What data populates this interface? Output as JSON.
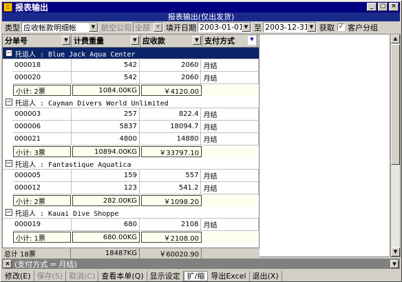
{
  "window": {
    "title": "报表输出",
    "subtitle": "报表输出(仅出发货)",
    "minimize": "_",
    "restore": "□",
    "close": "×",
    "icon_glyph": "☰"
  },
  "filters": {
    "type_label": "类型",
    "type_value": "应收帐款明细帐",
    "airline_label": "航空公司",
    "airline_value": "全部",
    "date_label": "填开日期",
    "date_from": "2003-01-01",
    "to_label": "至",
    "date_to": "2003-12-31",
    "fetch_label": "获取",
    "fetch_checked": "✓",
    "group_label": "客户分组"
  },
  "columns": [
    "分单号",
    "计费重量",
    "应收款",
    "支付方式"
  ],
  "groups": [
    {
      "label": "托运人 : Blue Jack Aqua Center",
      "rows": [
        {
          "id": "000018",
          "weight": "542",
          "amount": "2060",
          "pay": "月结"
        },
        {
          "id": "000020",
          "weight": "542",
          "amount": "2060",
          "pay": "月结"
        }
      ],
      "subtotal": {
        "label": "小计: 2票",
        "weight": "1084.00KG",
        "amount": "￥4120.00"
      }
    },
    {
      "label": "托运人 : Cayman Divers World Unlimited",
      "rows": [
        {
          "id": "000003",
          "weight": "257",
          "amount": "822.4",
          "pay": "月结"
        },
        {
          "id": "000006",
          "weight": "5837",
          "amount": "18094.7",
          "pay": "月结"
        },
        {
          "id": "000021",
          "weight": "4800",
          "amount": "14880",
          "pay": "月结"
        }
      ],
      "subtotal": {
        "label": "小计: 3票",
        "weight": "10894.00KG",
        "amount": "￥33797.10"
      }
    },
    {
      "label": "托运人 : Fantastique Aquatica",
      "rows": [
        {
          "id": "000005",
          "weight": "159",
          "amount": "557",
          "pay": "月结"
        },
        {
          "id": "000012",
          "weight": "123",
          "amount": "541.2",
          "pay": "月结"
        }
      ],
      "subtotal": {
        "label": "小计: 2票",
        "weight": "282.00KG",
        "amount": "￥1098.20"
      }
    },
    {
      "label": "托运人 : Kauai Dive Shoppe",
      "rows": [
        {
          "id": "000019",
          "weight": "680",
          "amount": "2108",
          "pay": "月结"
        }
      ],
      "subtotal": {
        "label": "小计: 1票",
        "weight": "680.00KG",
        "amount": "￥2108.00"
      }
    }
  ],
  "total": {
    "label": "总计 18票",
    "weight": "18487KG",
    "amount": "￥60020.90"
  },
  "filter_status": "(支付方式 = 月结)",
  "bottom_buttons": [
    {
      "label": "修改(E)",
      "enabled": true
    },
    {
      "label": "保存(S)",
      "enabled": false
    },
    {
      "label": "取消(C)",
      "enabled": false
    },
    {
      "label": "查看本单(Q)",
      "enabled": true
    },
    {
      "label": "显示设定",
      "enabled": true
    },
    {
      "label": "扩/缩",
      "enabled": true
    },
    {
      "label": "导出Excel",
      "enabled": true
    },
    {
      "label": "退出(X)",
      "enabled": true
    }
  ]
}
